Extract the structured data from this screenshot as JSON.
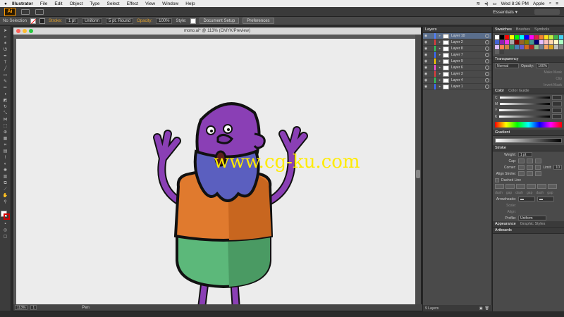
{
  "menubar": {
    "app_name": "Illustrator",
    "items": [
      "File",
      "Edit",
      "Object",
      "Type",
      "Select",
      "Effect",
      "View",
      "Window",
      "Help"
    ],
    "clock": "Wed 8:36 PM",
    "user": "Apple"
  },
  "appbar": {
    "logo": "Ai",
    "workspace": "Essentials ▾"
  },
  "control": {
    "selection": "No Selection",
    "stroke_label": "Stroke:",
    "stroke_weight": "1 pt",
    "profile": "Uniform",
    "brush": "5 pt. Round",
    "opacity_label": "Opacity:",
    "opacity": "100%",
    "style_label": "Style:",
    "document_setup": "Document Setup",
    "preferences": "Preferences"
  },
  "document": {
    "title": "mono.ai* @ 113% (CMYK/Preview)",
    "zoom": "113%",
    "page": "1",
    "status_tool": "Pen"
  },
  "watermark": "www.cg-ku.com",
  "layers_panel": {
    "tab": "Layers",
    "layers": [
      {
        "name": "Layer 10",
        "color": "#4f7fff",
        "selected": true
      },
      {
        "name": "Layer 2",
        "color": "#e23c3c",
        "selected": false
      },
      {
        "name": "Layer 8",
        "color": "#34c759",
        "selected": false
      },
      {
        "name": "Layer 7",
        "color": "#3a6bff",
        "selected": false
      },
      {
        "name": "Layer 9",
        "color": "#ffcc00",
        "selected": false
      },
      {
        "name": "Layer 6",
        "color": "#ff4fd8",
        "selected": false
      },
      {
        "name": "Layer 3",
        "color": "#e23c3c",
        "selected": false
      },
      {
        "name": "Layer 4",
        "color": "#34c759",
        "selected": false
      },
      {
        "name": "Layer 1",
        "color": "#3a6bff",
        "selected": false
      }
    ],
    "footer": "9 Layers"
  },
  "right_panels": {
    "swatches_tabs": [
      "Swatches",
      "Brushes",
      "Symbols"
    ],
    "transparency": {
      "title": "Transparency",
      "mode": "Normal",
      "opacity_label": "Opacity:",
      "opacity": "100%",
      "make_mask": "Make Mask",
      "clip": "Clip",
      "invert_mask": "Invert Mask"
    },
    "color_tabs": [
      "Color",
      "Color Guide"
    ],
    "color_channels": [
      "C",
      "M",
      "Y",
      "K"
    ],
    "gradient_title": "Gradient",
    "stroke": {
      "title": "Stroke",
      "weight_label": "Weight:",
      "weight": "1 pt",
      "cap_label": "Cap:",
      "corner_label": "Corner:",
      "limit_label": "Limit:",
      "limit": "10",
      "align_label": "Align Stroke:",
      "dashed_label": "Dashed Line",
      "dash_labels": [
        "dash",
        "gap",
        "dash",
        "gap",
        "dash",
        "gap"
      ],
      "arrowheads_label": "Arrowheads:",
      "scale_label": "Scale:",
      "align2_label": "Align:",
      "profile_label": "Profile:",
      "profile": "Uniform"
    },
    "bottom_tabs": [
      "Appearance",
      "Graphic Styles"
    ],
    "artboards": "Artboards"
  },
  "swatch_colors": [
    "#ffffff",
    "#000000",
    "#ff0000",
    "#ffff00",
    "#00ff00",
    "#00ffff",
    "#0000ff",
    "#ff00ff",
    "#e6194b",
    "#f58231",
    "#ffe119",
    "#bfef45",
    "#3cb44b",
    "#42d4f4",
    "#4363d8",
    "#911eb4",
    "#f032e6",
    "#a9a9a9",
    "#800000",
    "#9a6324",
    "#808000",
    "#469990",
    "#000075",
    "#e6beff",
    "#fabebe",
    "#ffd8b1",
    "#fffac8",
    "#aaffc3",
    "#dcbeff",
    "#ff7f50",
    "#cd853f",
    "#2e8b57",
    "#4682b4",
    "#6a5acd",
    "#d2691e",
    "#b22222",
    "#8fbc8f",
    "#708090",
    "#f4a460",
    "#daa520",
    "#c0c0c0",
    "#808080",
    "#606060",
    "#404040"
  ]
}
